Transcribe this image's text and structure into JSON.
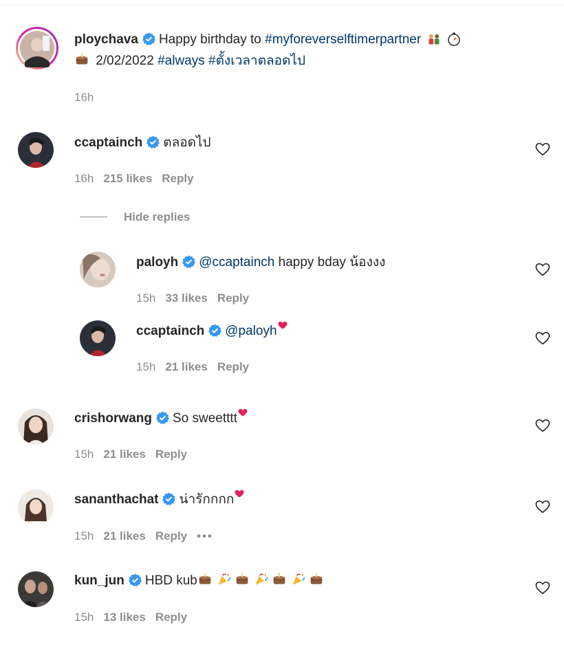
{
  "caption": {
    "username": "ploychava",
    "text_prefix": "Happy birthday to ",
    "hashtag_main": "#myforeverselftimerpartner",
    "date_text": " 2/02/2022 ",
    "hashtag_always": "#always",
    "hashtag_thai": "#ตั้งเวลาตลอดไป",
    "time": "16h",
    "icons": [
      "couple-emoji",
      "timer-clock-emoji",
      "cake-emoji"
    ]
  },
  "comments": [
    {
      "username": "ccaptainch",
      "text": "ตลอดไป",
      "time": "16h",
      "likes": "215 likes",
      "reply_label": "Reply",
      "hide_replies_label": "Hide replies",
      "replies": [
        {
          "username": "paloyh",
          "mention": "@ccaptainch",
          "text": " happy bday น้องงง",
          "time": "15h",
          "likes": "33 likes",
          "reply_label": "Reply"
        },
        {
          "username": "ccaptainch",
          "mention": "@paloyh",
          "text": "",
          "time": "15h",
          "likes": "21 likes",
          "reply_label": "Reply",
          "icons": [
            "red-heart-emoji"
          ]
        }
      ]
    },
    {
      "username": "crishorwang",
      "text": "So sweetttt",
      "time": "15h",
      "likes": "21 likes",
      "reply_label": "Reply",
      "icons": [
        "red-heart-emoji"
      ]
    },
    {
      "username": "sananthachat",
      "text": "น่ารักกกก",
      "time": "15h",
      "likes": "21 likes",
      "reply_label": "Reply",
      "more_label": "•••",
      "icons": [
        "red-heart-emoji"
      ]
    },
    {
      "username": "kun_jun",
      "text": "HBD kub",
      "time": "15h",
      "likes": "13 likes",
      "reply_label": "Reply",
      "icons": [
        "cake-emoji",
        "party-popper-emoji"
      ]
    }
  ],
  "colors": {
    "text": "#262626",
    "muted": "#8e8e8e",
    "link": "#00376b",
    "verified": "#3897f0",
    "story_ring": "#d6249f",
    "red_heart": "#e0245e"
  }
}
